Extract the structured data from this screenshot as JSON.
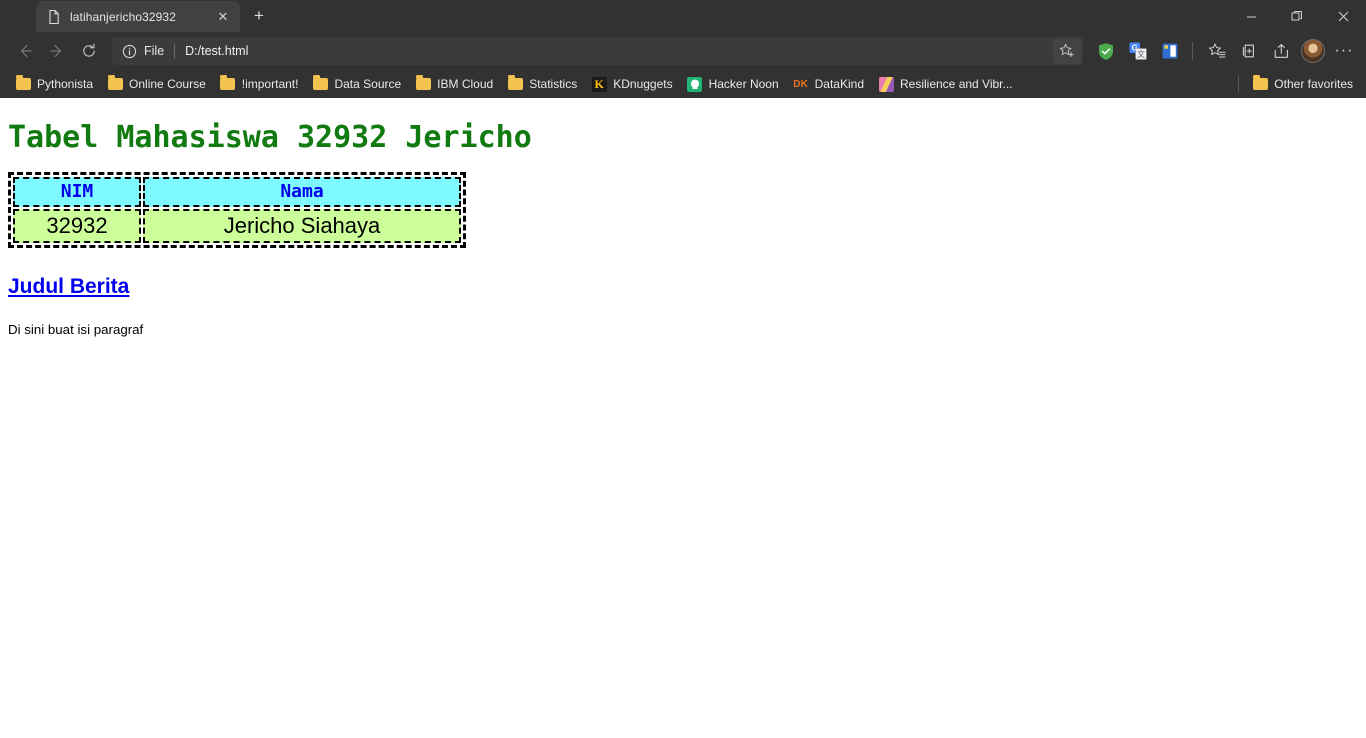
{
  "window": {
    "controls": [
      {
        "name": "minimize",
        "glyph": "–"
      },
      {
        "name": "restore",
        "glyph": "❐"
      },
      {
        "name": "close",
        "glyph": "✕"
      }
    ]
  },
  "tabstrip": {
    "tabs": [
      {
        "title": "latihanjericho32932",
        "favicon": "page-icon",
        "close_glyph": "✕"
      }
    ],
    "new_tab_glyph": "+",
    "new_tab_label": "New tab"
  },
  "navbar": {
    "back_label": "Back",
    "forward_label": "Forward",
    "refresh_label": "Refresh",
    "address": {
      "info_glyph": "ⓘ",
      "scheme_label": "File",
      "url": "D:/test.html",
      "placeholder": "Search or enter web address",
      "favorite_label": "Add this page to favorites"
    },
    "extensions": [
      {
        "name": "adguard-icon",
        "title": "AdGuard",
        "color": "#4caf50"
      },
      {
        "name": "google-translate-icon",
        "title": "Google Translate",
        "color": "#4285f4"
      },
      {
        "name": "blue-extension-icon",
        "title": "Extension",
        "color": "#2f6fd0"
      }
    ],
    "tools": [
      {
        "name": "favorites-icon",
        "title": "Favorites"
      },
      {
        "name": "collections-icon",
        "title": "Collections"
      },
      {
        "name": "share-icon",
        "title": "Share"
      }
    ],
    "profile_label": "Profile",
    "settings_glyph": "···",
    "settings_label": "Settings and more"
  },
  "bookmarks": {
    "items": [
      {
        "label": "Pythonista",
        "icon": "folder-icon"
      },
      {
        "label": "Online Course",
        "icon": "folder-icon"
      },
      {
        "label": "!important!",
        "icon": "folder-icon"
      },
      {
        "label": "Data Source",
        "icon": "folder-icon"
      },
      {
        "label": "IBM Cloud",
        "icon": "folder-icon"
      },
      {
        "label": "Statistics",
        "icon": "folder-icon"
      },
      {
        "label": "KDnuggets",
        "icon": "kdnuggets-icon"
      },
      {
        "label": "Hacker Noon",
        "icon": "hackernoon-icon"
      },
      {
        "label": "DataKind",
        "icon": "datakind-icon"
      },
      {
        "label": "Resilience and Vibr...",
        "icon": "resilience-icon"
      }
    ],
    "other_favorites": {
      "label": "Other favorites",
      "icon": "folder-icon"
    }
  },
  "page": {
    "heading": "Tabel Mahasiswa 32932 Jericho",
    "table": {
      "headers": [
        "NIM",
        "Nama"
      ],
      "rows": [
        [
          "32932",
          "Jericho Siahaya"
        ]
      ],
      "header_bg": "#7DF9FF",
      "header_color": "#0000EE",
      "cell_bg": "#CCFF99",
      "cell_color": "#000000",
      "border_style": "dashed"
    },
    "link_heading": "Judul Berita",
    "paragraph": "Di sini buat isi paragraf",
    "heading_color": "#117a11",
    "link_color": "#0000EE"
  }
}
